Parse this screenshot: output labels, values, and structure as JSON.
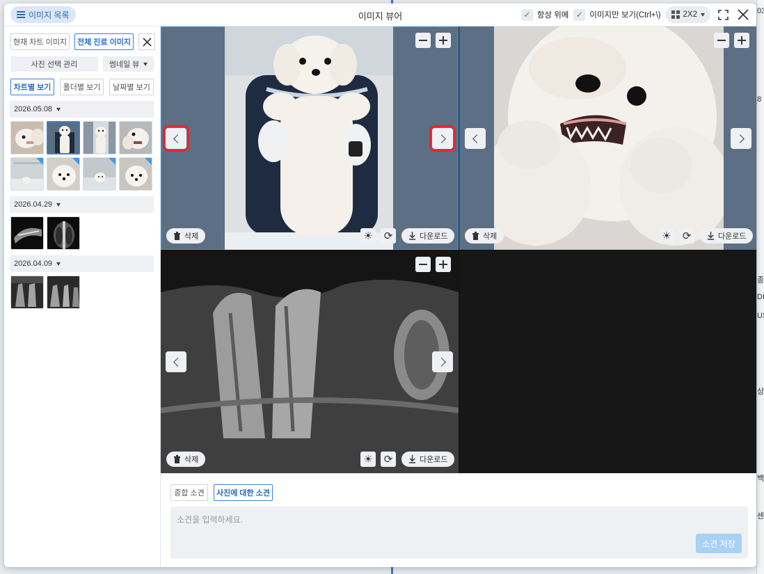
{
  "window": {
    "title": "이미지 뷰어"
  },
  "header": {
    "image_list_label": "이미지 목록",
    "always_on_top_label": "항상 위에",
    "image_only_label": "이미지만 보기(Ctrl+\\)",
    "grid_layout_value": "2X2"
  },
  "sidebar": {
    "current_chart_images_label": "현재 차트 이미지",
    "all_treatment_images_label": "전체 진료 이미지",
    "photo_select_manage_label": "사진 선택 관리",
    "thumbnail_view_label": "썸네일 뷰",
    "view_by_chart_label": "차트별 보기",
    "view_by_folder_label": "폴더별 보기",
    "view_by_date_label": "날짜별 보기",
    "groups": [
      {
        "date": "2026.05.08",
        "count": 8
      },
      {
        "date": "2026.04.29",
        "count": 2
      },
      {
        "date": "2026.04.09",
        "count": 2
      }
    ]
  },
  "viewer": {
    "delete_label": "삭제",
    "download_label": "다운로드",
    "panes": [
      {
        "content": "dog-standing-photo",
        "active": true
      },
      {
        "content": "dog-teeth-photo",
        "active": false
      },
      {
        "content": "dental-xray",
        "active": false
      },
      {
        "content": "empty",
        "active": false
      }
    ]
  },
  "bottom": {
    "overall_findings_tab": "종합 소견",
    "photo_findings_tab": "사진에 대한 소견",
    "memo_placeholder": "소견을 입력하세요.",
    "save_label": "소견 저장"
  },
  "background": {
    "fragments": [
      "03",
      "8",
      "종",
      "DI",
      "US",
      "상",
      "백상",
      "센..."
    ]
  },
  "colors": {
    "accent": "#3b7ddd",
    "highlight": "#e8262b",
    "save_disabled": "#a9d0f5"
  }
}
